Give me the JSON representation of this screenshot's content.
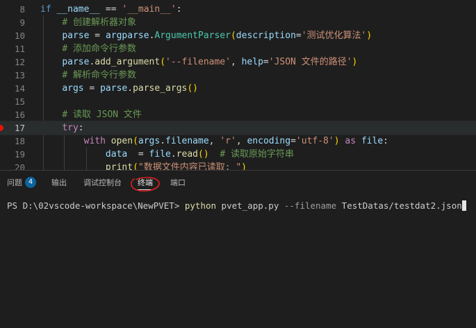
{
  "editor": {
    "lines": [
      {
        "num": "8",
        "tokens": [
          [
            "kwb",
            "if"
          ],
          [
            "op",
            " "
          ],
          [
            "var",
            "__name__"
          ],
          [
            "op",
            " == "
          ],
          [
            "str",
            "'__main__'"
          ],
          [
            "op",
            ":"
          ]
        ]
      },
      {
        "num": "9",
        "tokens": [
          [
            "op",
            "    "
          ],
          [
            "cmt",
            "# 创建解析器对象"
          ]
        ]
      },
      {
        "num": "10",
        "tokens": [
          [
            "op",
            "    "
          ],
          [
            "var",
            "parse"
          ],
          [
            "op",
            " = "
          ],
          [
            "var",
            "argparse"
          ],
          [
            "op",
            "."
          ],
          [
            "cls",
            "ArgumentParser"
          ],
          [
            "br1",
            "("
          ],
          [
            "var",
            "description"
          ],
          [
            "op",
            "="
          ],
          [
            "str",
            "'测试优化算法'"
          ],
          [
            "br1",
            ")"
          ]
        ]
      },
      {
        "num": "11",
        "tokens": [
          [
            "op",
            "    "
          ],
          [
            "cmt",
            "# 添加命令行参数"
          ]
        ]
      },
      {
        "num": "12",
        "tokens": [
          [
            "op",
            "    "
          ],
          [
            "var",
            "parse"
          ],
          [
            "op",
            "."
          ],
          [
            "fn",
            "add_argument"
          ],
          [
            "br1",
            "("
          ],
          [
            "str",
            "'--filename'"
          ],
          [
            "op",
            ", "
          ],
          [
            "var",
            "help"
          ],
          [
            "op",
            "="
          ],
          [
            "str",
            "'JSON 文件的路径'"
          ],
          [
            "br1",
            ")"
          ]
        ]
      },
      {
        "num": "13",
        "tokens": [
          [
            "op",
            "    "
          ],
          [
            "cmt",
            "# 解析命令行参数"
          ]
        ]
      },
      {
        "num": "14",
        "tokens": [
          [
            "op",
            "    "
          ],
          [
            "var",
            "args"
          ],
          [
            "op",
            " = "
          ],
          [
            "var",
            "parse"
          ],
          [
            "op",
            "."
          ],
          [
            "fn",
            "parse_args"
          ],
          [
            "br1",
            "()"
          ]
        ]
      },
      {
        "num": "15",
        "tokens": []
      },
      {
        "num": "16",
        "tokens": [
          [
            "op",
            "    "
          ],
          [
            "cmt",
            "# 读取 JSON 文件"
          ]
        ]
      },
      {
        "num": "17",
        "tokens": [
          [
            "op",
            "    "
          ],
          [
            "kw",
            "try"
          ],
          [
            "op",
            ":"
          ]
        ]
      },
      {
        "num": "18",
        "tokens": [
          [
            "op",
            "        "
          ],
          [
            "kw",
            "with"
          ],
          [
            "op",
            " "
          ],
          [
            "fn",
            "open"
          ],
          [
            "br1",
            "("
          ],
          [
            "var",
            "args"
          ],
          [
            "op",
            "."
          ],
          [
            "var",
            "filename"
          ],
          [
            "op",
            ", "
          ],
          [
            "str",
            "'r'"
          ],
          [
            "op",
            ", "
          ],
          [
            "var",
            "encoding"
          ],
          [
            "op",
            "="
          ],
          [
            "str",
            "'utf-8'"
          ],
          [
            "br1",
            ")"
          ],
          [
            "op",
            " "
          ],
          [
            "kw",
            "as"
          ],
          [
            "op",
            " "
          ],
          [
            "var",
            "file"
          ],
          [
            "op",
            ":"
          ]
        ]
      },
      {
        "num": "19",
        "tokens": [
          [
            "op",
            "            "
          ],
          [
            "var",
            "data"
          ],
          [
            "op",
            "  = "
          ],
          [
            "var",
            "file"
          ],
          [
            "op",
            "."
          ],
          [
            "fn",
            "read"
          ],
          [
            "br1",
            "()"
          ],
          [
            "op",
            "  "
          ],
          [
            "cmt",
            "# 读取原始字符串"
          ]
        ]
      },
      {
        "num": "20",
        "tokens": [
          [
            "op",
            "            "
          ],
          [
            "fn",
            "print"
          ],
          [
            "br1",
            "("
          ],
          [
            "str",
            "\"数据文件内容已读取: \""
          ],
          [
            "br1",
            ")"
          ]
        ]
      }
    ]
  },
  "panel": {
    "tabs": [
      {
        "label": "问题",
        "badge": "4"
      },
      {
        "label": "输出"
      },
      {
        "label": "调试控制台"
      },
      {
        "label": "终端"
      },
      {
        "label": "端口"
      }
    ]
  },
  "terminal": {
    "prompt": "PS D:\\02vscode-workspace\\NewPVET> ",
    "command": "python",
    "arg": " pvet_app.py ",
    "flag": "--filename",
    "file": " TestDatas/testdat2.json"
  }
}
